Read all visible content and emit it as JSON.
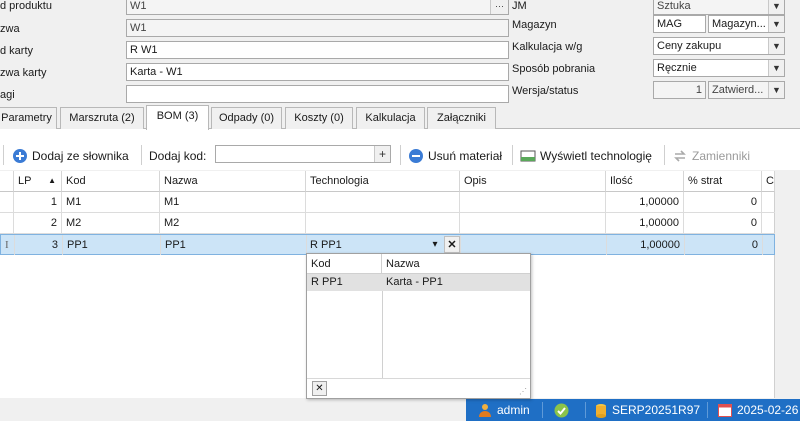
{
  "form": {
    "kod_produktu_label": "d produktu",
    "kod_produktu_value": "W1",
    "nazwa_label": "zwa",
    "nazwa_value": "W1",
    "kod_karty_label": "d karty",
    "kod_karty_value": "R W1",
    "nazwa_karty_label": "zwa karty",
    "nazwa_karty_value": "Karta - W1",
    "uwagi_label": "agi",
    "uwagi_value": "",
    "jm_label": "JM",
    "jm_value": "Sztuka",
    "magazyn_label": "Magazyn",
    "magazyn_code": "MAG",
    "magazyn_name": "Magazyn...",
    "kalkulacja_label": "Kalkulacja w/g",
    "kalkulacja_value": "Ceny zakupu",
    "sposob_label": "Sposób pobrania",
    "sposob_value": "Ręcznie",
    "wersja_label": "Wersja/status",
    "wersja_value": "1",
    "status_value": "Zatwierd..."
  },
  "tabs": [
    {
      "label": "Parametry"
    },
    {
      "label": "Marszruta (2)"
    },
    {
      "label": "BOM (3)"
    },
    {
      "label": "Odpady (0)"
    },
    {
      "label": "Koszty (0)"
    },
    {
      "label": "Kalkulacja"
    },
    {
      "label": "Załączniki"
    }
  ],
  "toolbar": {
    "add_from_dict": "Dodaj ze słownika",
    "add_code_label": "Dodaj kod:",
    "add_code_value": "",
    "remove_material": "Usuń materiał",
    "show_technology": "Wyświetl technologię",
    "substitutes": "Zamienniki"
  },
  "grid": {
    "columns": [
      "LP",
      "Kod",
      "Nazwa",
      "Technologia",
      "Opis",
      "Ilość",
      "% strat",
      "Ce"
    ],
    "rows": [
      {
        "lp": "1",
        "kod": "M1",
        "nazwa": "M1",
        "technologia": "",
        "opis": "",
        "ilosc": "1,00000",
        "strat": "0"
      },
      {
        "lp": "2",
        "kod": "M2",
        "nazwa": "M2",
        "technologia": "",
        "opis": "",
        "ilosc": "1,00000",
        "strat": "0"
      },
      {
        "lp": "3",
        "kod": "PP1",
        "nazwa": "PP1",
        "technologia": "R PP1",
        "opis": "",
        "ilosc": "1,00000",
        "strat": "0"
      }
    ],
    "row_indicator": "I"
  },
  "popup": {
    "columns": [
      "Kod",
      "Nazwa"
    ],
    "rows": [
      {
        "kod": "R PP1",
        "nazwa": "Karta - PP1"
      }
    ]
  },
  "status": {
    "user": "admin",
    "db": "SERP20251R97",
    "date": "2025-02-26"
  },
  "colors": {
    "statusbar": "#1f6fc5",
    "selection": "#cce4f7"
  }
}
